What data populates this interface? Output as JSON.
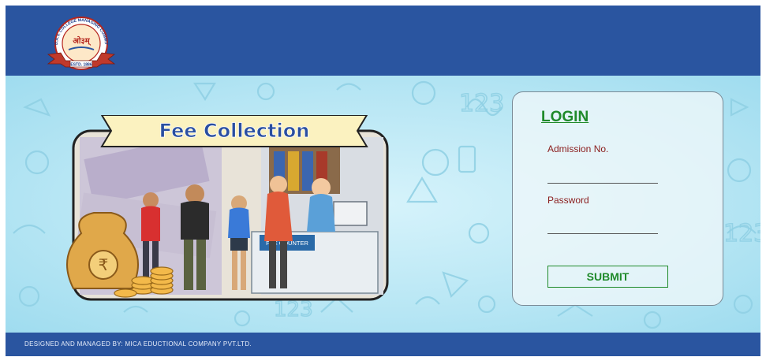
{
  "header": {
    "logo": {
      "arc_text": "D.A.V. COLLEGE MANAGING COMMITTEE",
      "center_text": "ओ३म्",
      "estd_text": "ESTD. 1886"
    }
  },
  "banner": {
    "title": "Fee Collection",
    "counter_label": "FEE COUNTER"
  },
  "login": {
    "title": "LOGIN",
    "admission_label": "Admission No.",
    "admission_value": "",
    "password_label": "Password",
    "password_value": "",
    "submit_label": "SUBMIT"
  },
  "footer": {
    "text": "DESIGNED AND MANAGED BY: MICA EDUCTIONAL COMPANY PVT.LTD."
  },
  "colors": {
    "header_blue": "#2a55a0",
    "login_green": "#1f8a2a",
    "label_red": "#8a1c1c",
    "background_light_blue": "#c6ecf7"
  }
}
